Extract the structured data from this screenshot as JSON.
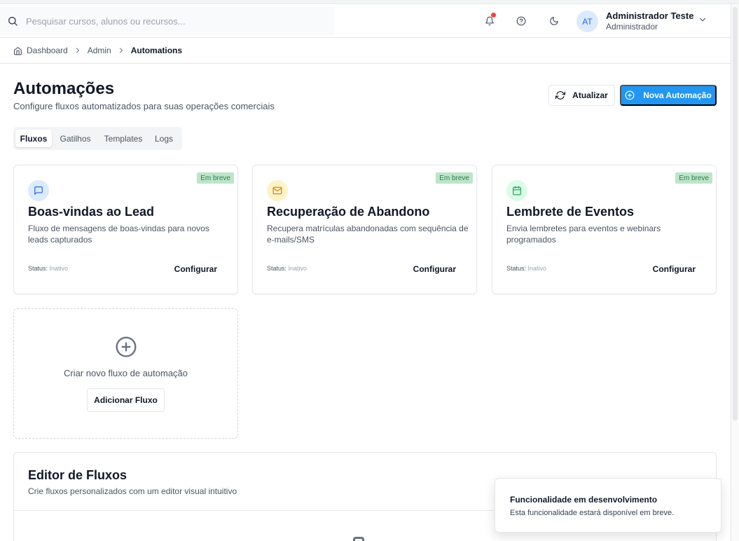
{
  "header": {
    "search_placeholder": "Pesquisar cursos, alunos ou recursos...",
    "user": {
      "initials": "AT",
      "name": "Administrador Teste",
      "role": "Administrador"
    }
  },
  "breadcrumb": [
    "Dashboard",
    "Admin",
    "Automations"
  ],
  "page": {
    "title": "Automações",
    "subtitle": "Configure fluxos automatizados para suas operações comerciais",
    "refresh_label": "Atualizar",
    "new_label": "Nova Automação"
  },
  "tabs": [
    "Fluxos",
    "Gatilhos",
    "Templates",
    "Logs"
  ],
  "active_tab": "Fluxos",
  "cards": [
    {
      "icon": "message-square-icon",
      "badge": "Em breve",
      "title": "Boas-vindas ao Lead",
      "description": "Fluxo de mensagens de boas-vindas para novos leads capturados",
      "status_label": "Status:",
      "status_value": "Inativo",
      "action": "Configurar",
      "icon_bg": "#dbeafe",
      "icon_color": "#2563eb"
    },
    {
      "icon": "mail-icon",
      "badge": "Em breve",
      "title": "Recuperação de Abandono",
      "description": "Recupera matrículas abandonadas com sequência de e-mails/SMS",
      "status_label": "Status:",
      "status_value": "Inativo",
      "action": "Configurar",
      "icon_bg": "#fef3c7",
      "icon_color": "#d97706"
    },
    {
      "icon": "calendar-icon",
      "badge": "Em breve",
      "title": "Lembrete de Eventos",
      "description": "Envia lembretes para eventos e webinars programados",
      "status_label": "Status:",
      "status_value": "Inativo",
      "action": "Configurar",
      "icon_bg": "#dcfce7",
      "icon_color": "#16a34a"
    }
  ],
  "new_flow": {
    "text": "Criar novo fluxo de automação",
    "button": "Adicionar Fluxo"
  },
  "editor": {
    "title": "Editor de Fluxos",
    "subtitle": "Crie fluxos personalizados com um editor visual intuitivo"
  },
  "toast": {
    "title": "Funcionalidade em desenvolvimento",
    "description": "Esta funcionalidade estará disponível em breve."
  },
  "colors": {
    "primary": "#2196f3",
    "badge_bg": "#bde5c8",
    "badge_text": "#2e7d4f",
    "notification_dot": "#ef4444"
  }
}
